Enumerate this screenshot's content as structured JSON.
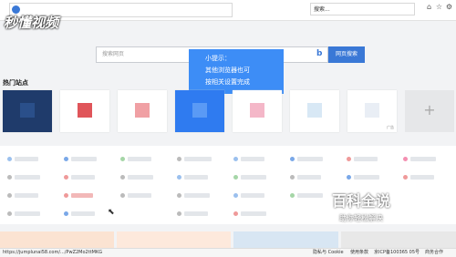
{
  "browser": {
    "search_value": "搜索..."
  },
  "watermark": "秒懂视频",
  "search": {
    "placeholder": "搜索网页",
    "button_label": "网页搜索"
  },
  "tip": {
    "title": "小提示：",
    "line1": "其他浏览器也可",
    "line2": "按相关设置完成"
  },
  "section": {
    "hot_title": "热门站点"
  },
  "tiles": [
    {
      "ad": ""
    },
    {
      "ad": ""
    },
    {
      "ad": ""
    },
    {
      "ad": ""
    },
    {
      "ad": ""
    },
    {
      "ad": ""
    },
    {
      "ad": "广告"
    }
  ],
  "add_tile": {
    "symbol": "+"
  },
  "colors": {
    "accent": "#3a78d6",
    "tip_bg": "#3d8df6"
  },
  "status": {
    "url": "https://jumplunai58.com/.../PwZ2Mo2ttMKG",
    "links": [
      "隐私与 Cookie",
      "使用条款",
      "京ICP备100365 05号",
      "商务合作"
    ]
  },
  "brand": {
    "line1": "百科全说",
    "line2": "助你轻松解决"
  }
}
